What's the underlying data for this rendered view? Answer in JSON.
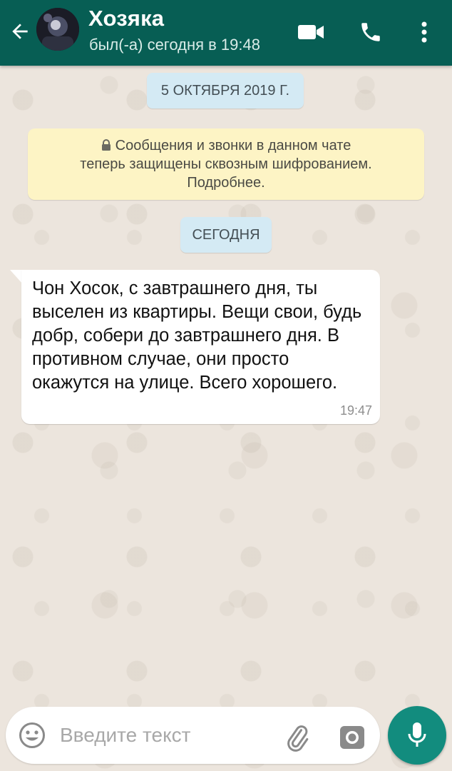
{
  "header": {
    "contact_name": "Хозяка",
    "status": "был(-а) сегодня в 19:48"
  },
  "chat": {
    "date_chip": "5 ОКТЯБРЯ 2019 Г.",
    "encryption_notice_line1": "Сообщения и звонки в данном чате",
    "encryption_notice_line2": "теперь защищены сквозным шифрованием.",
    "encryption_notice_line3": "Подробнее.",
    "today_chip": "СЕГОДНЯ",
    "messages": [
      {
        "text": "Чон Хосок, с завтрашнего дня, ты выселен из квартиры. Вещи свои, будь добр, собери до завтрашнего дня. В противном случае, они просто окажутся на улице. Всего хорошего.",
        "time": "19:47"
      }
    ]
  },
  "input": {
    "placeholder": "Введите текст"
  },
  "colors": {
    "header": "#075e54",
    "mic_button": "#128c7e",
    "chat_bg": "#ece5dd",
    "notice_bg": "#fdf4c5",
    "chip_bg": "#d4eaf4"
  },
  "icons": {
    "back": "arrow-left-icon",
    "video": "video-camera-icon",
    "call": "phone-icon",
    "more": "more-vertical-icon",
    "lock": "lock-icon",
    "emoji": "emoji-icon",
    "attach": "paperclip-icon",
    "camera": "camera-icon",
    "mic": "microphone-icon"
  }
}
